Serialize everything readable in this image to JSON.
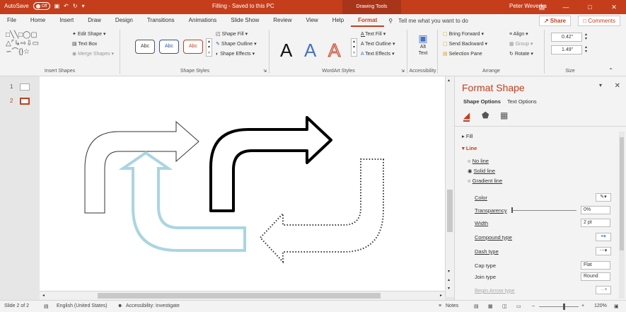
{
  "titlebar": {
    "autosave_label": "AutoSave",
    "autosave_state": "Off",
    "doc_title": "Filling - Saved to this PC",
    "context_tab": "Drawing Tools",
    "user": "Peter Weverka",
    "accent_color": "#c43e1c"
  },
  "tabs": {
    "items": [
      "File",
      "Home",
      "Insert",
      "Draw",
      "Design",
      "Transitions",
      "Animations",
      "Slide Show",
      "Review",
      "View",
      "Help",
      "Format"
    ],
    "active": "Format",
    "tell_me": "Tell me what you want to do",
    "share": "Share",
    "comments": "Comments"
  },
  "ribbon": {
    "insert_shapes": {
      "label": "Insert Shapes",
      "edit_shape": "Edit Shape",
      "text_box": "Text Box",
      "merge_shapes": "Merge Shapes"
    },
    "shape_styles": {
      "label": "Shape Styles",
      "abc": "Abc",
      "shape_fill": "Shape Fill",
      "shape_outline": "Shape Outline",
      "shape_effects": "Shape Effects"
    },
    "wordart": {
      "label": "WordArt Styles",
      "letter": "A",
      "text_fill": "Text Fill",
      "text_outline": "Text Outline",
      "text_effects": "Text Effects"
    },
    "accessibility": {
      "label": "Accessibility",
      "alt_text_line1": "Alt",
      "alt_text_line2": "Text"
    },
    "arrange": {
      "label": "Arrange",
      "bring_forward": "Bring Forward",
      "send_backward": "Send Backward",
      "selection_pane": "Selection Pane",
      "align": "Align",
      "group": "Group",
      "rotate": "Rotate"
    },
    "size": {
      "label": "Size",
      "height": "0.42\"",
      "width": "1.49\""
    }
  },
  "thumbs": [
    {
      "num": "1"
    },
    {
      "num": "2"
    }
  ],
  "pane": {
    "title": "Format Shape",
    "tab_shape_options": "Shape Options",
    "tab_text_options": "Text Options",
    "fill": "Fill",
    "line": "Line",
    "no_line": "No line",
    "solid_line": "Solid line",
    "gradient_line": "Gradient line",
    "color": "Color",
    "transparency": "Transparency",
    "transparency_value": "0%",
    "width": "Width",
    "width_value": "2 pt",
    "compound_type": "Compound type",
    "dash_type": "Dash type",
    "cap_type": "Cap type",
    "cap_value": "Flat",
    "join_type": "Join type",
    "join_value": "Round",
    "begin_arrow_type": "Begin Arrow type"
  },
  "status": {
    "slide": "Slide 2 of 2",
    "language": "English (United States)",
    "accessibility": "Accessibility: Investigate",
    "notes": "Notes",
    "zoom": "120%"
  }
}
